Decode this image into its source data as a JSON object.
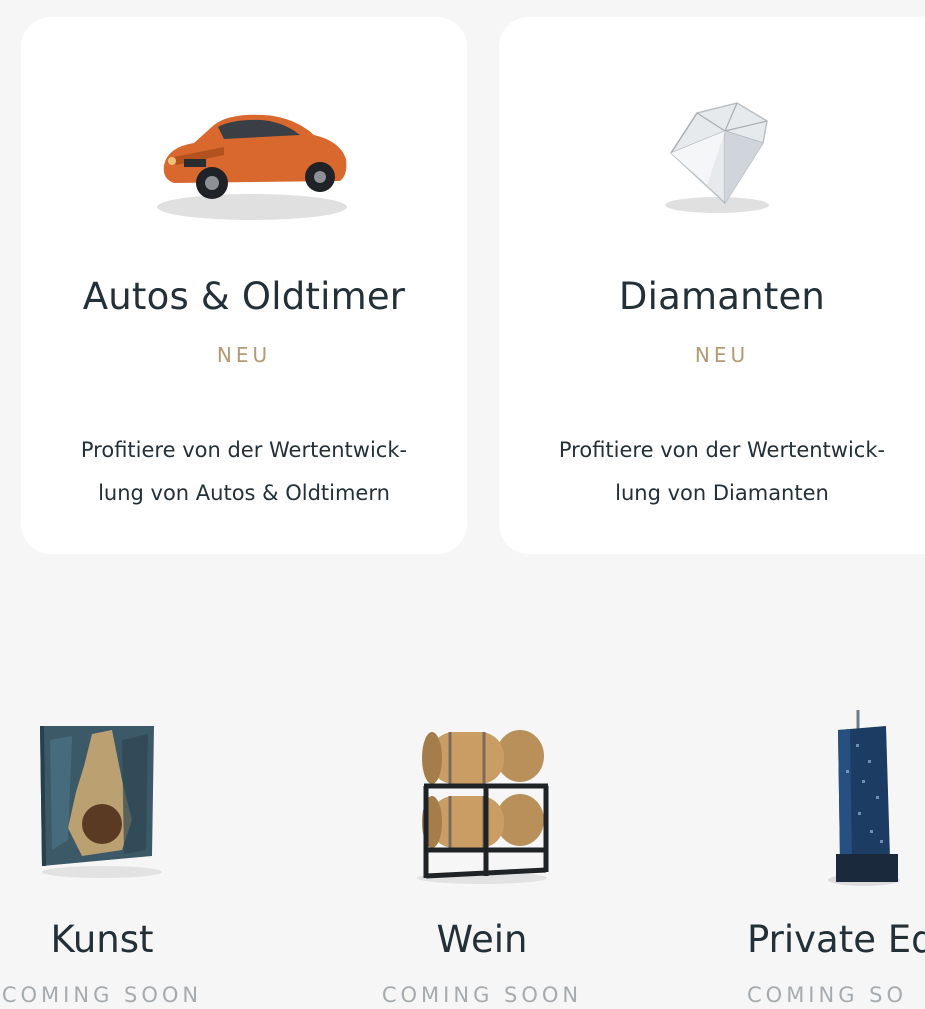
{
  "cards": [
    {
      "title": "Autos & Oldtimer",
      "badge": "NEU",
      "desc_line1": "Profitiere von der Wertentwick-",
      "desc_line2": "lung von Autos & Oldtimern",
      "icon": "car-icon"
    },
    {
      "title": "Diamanten",
      "badge": "NEU",
      "desc_line1": "Profitiere von der Wertentwick-",
      "desc_line2": "lung von Diamanten",
      "icon": "diamond-icon"
    }
  ],
  "tiles": [
    {
      "title": "Kunst",
      "status": "COMING SOON",
      "icon": "painting-icon"
    },
    {
      "title": "Wein",
      "status": "COMING SOON",
      "icon": "wine-barrels-icon"
    },
    {
      "title": "Private Eq",
      "status": "COMING SO",
      "icon": "skyscraper-icon"
    }
  ],
  "colors": {
    "background": "#f6f6f6",
    "card": "#ffffff",
    "text": "#233038",
    "accent_gold": "#b49a74",
    "muted": "#a6abaf",
    "car": "#d8682e"
  }
}
